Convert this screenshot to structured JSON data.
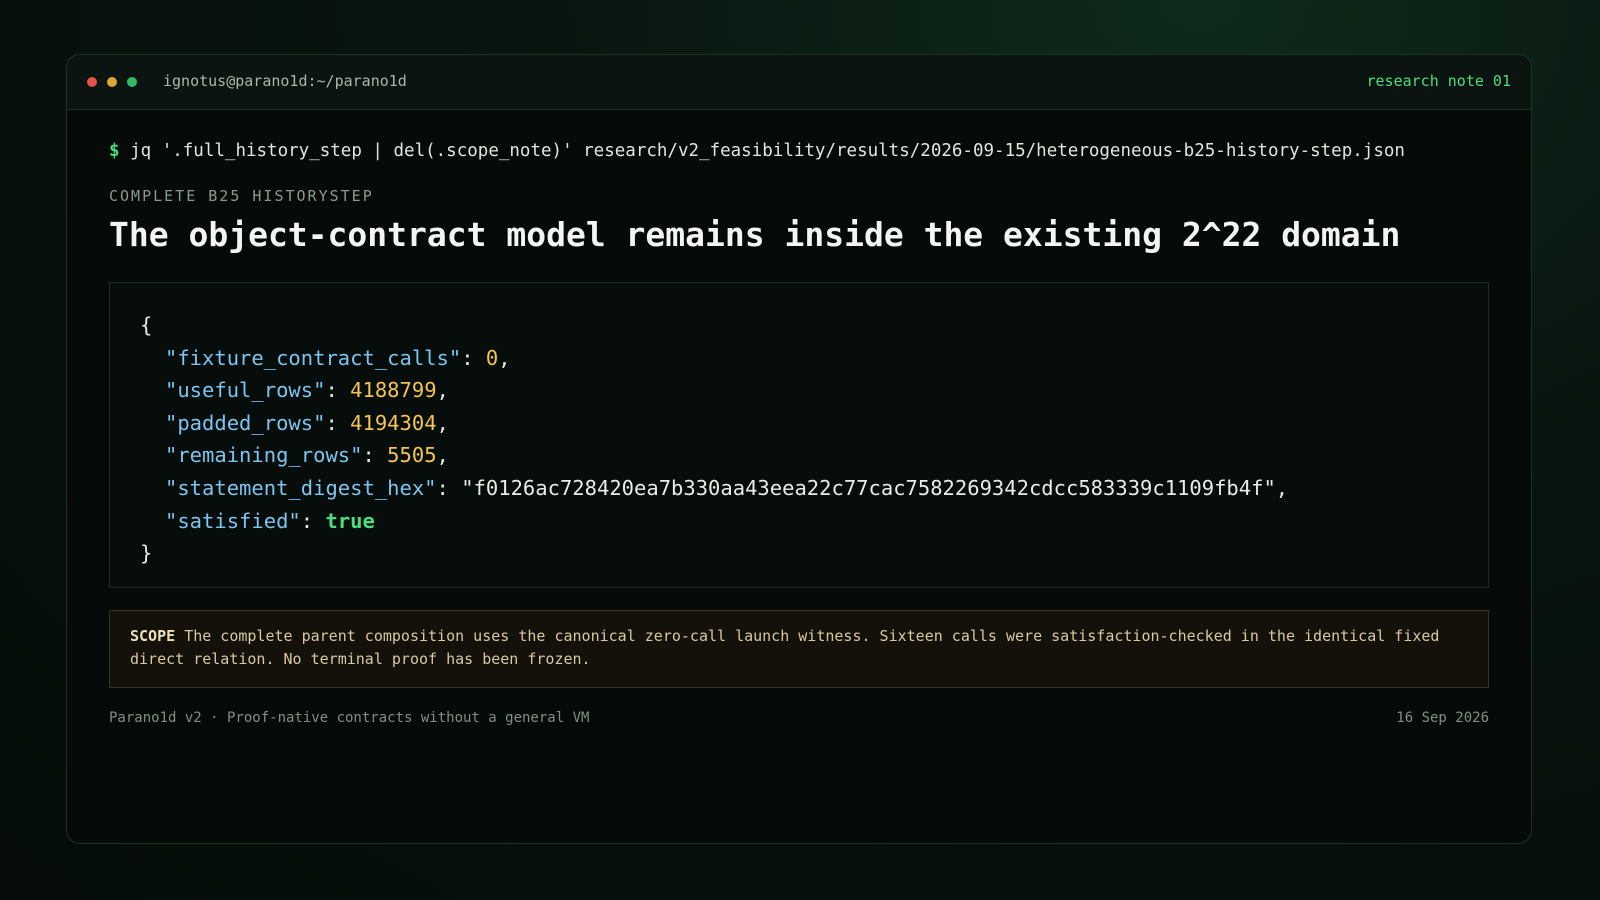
{
  "window": {
    "title": "ignotus@parano1d:~/parano1d",
    "tag": "research note 01"
  },
  "command": {
    "prompt": "$",
    "text": "jq '.full_history_step | del(.scope_note)' research/v2_feasibility/results/2026-09-15/heterogeneous-b25-history-step.json"
  },
  "section_label": "COMPLETE B25 HISTORYSTEP",
  "headline": "The object-contract model remains inside the existing 2^22 domain",
  "json_output": {
    "open_brace": "{",
    "close_brace": "}",
    "entries": [
      {
        "key": "\"fixture_contract_calls\"",
        "value": "0",
        "type": "num",
        "trail": ","
      },
      {
        "key": "\"useful_rows\"",
        "value": "4188799",
        "type": "num",
        "trail": ","
      },
      {
        "key": "\"padded_rows\"",
        "value": "4194304",
        "type": "num",
        "trail": ","
      },
      {
        "key": "\"remaining_rows\"",
        "value": "5505",
        "type": "num",
        "trail": ","
      },
      {
        "key": "\"statement_digest_hex\"",
        "value": "\"f0126ac728420ea7b330aa43eea22c77cac7582269342cdcc583339c1109fb4f\"",
        "type": "str",
        "trail": ","
      },
      {
        "key": "\"satisfied\"",
        "value": "true",
        "type": "bool",
        "trail": ""
      }
    ]
  },
  "scope": {
    "label": "SCOPE",
    "text": "The complete parent composition uses the canonical zero-call launch witness. Sixteen calls were satisfaction-checked in the identical fixed direct relation. No terminal proof has been frozen."
  },
  "footer": {
    "left": "Parano1d v2 · Proof-native contracts without a general VM",
    "right": "16 Sep 2026"
  },
  "colors": {
    "accent": "#4ade80",
    "json_key": "#7cc4f0",
    "json_number": "#f5c451",
    "dot_red": "#e5534b",
    "dot_yellow": "#d9a52f",
    "dot_green": "#33b864"
  }
}
